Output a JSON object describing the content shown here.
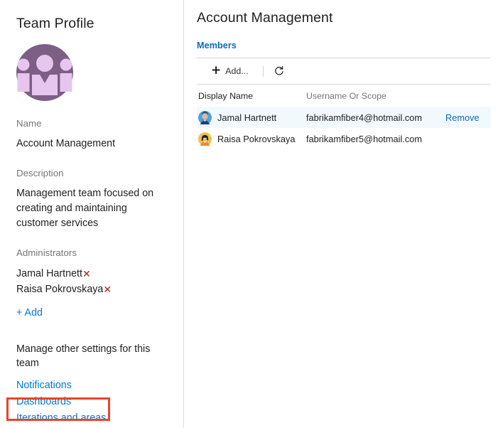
{
  "left_panel": {
    "title": "Team Profile",
    "avatar_icon": "team-group-avatar",
    "avatar_colors": {
      "circle": "#7d5f86",
      "figure": "#e6c6ef"
    },
    "name_label": "Name",
    "name_value": "Account Management",
    "description_label": "Description",
    "description_value": "Management team focused on creating and maintaining customer services",
    "administrators_label": "Administrators",
    "administrators": [
      {
        "name": "Jamal Hartnett",
        "remove_icon": "remove-x-icon"
      },
      {
        "name": "Raisa Pokrovskaya",
        "remove_icon": "remove-x-icon"
      }
    ],
    "add_admin_label": "+ Add",
    "manage_text": "Manage other settings for this team",
    "settings_links": [
      {
        "label": "Notifications",
        "highlighted": false
      },
      {
        "label": "Dashboards",
        "highlighted": false
      },
      {
        "label": "Iterations and areas",
        "highlighted": true
      }
    ],
    "highlight_color": "#e8442b"
  },
  "right_panel": {
    "title": "Account Management",
    "tabs": [
      {
        "label": "Members",
        "active": true
      }
    ],
    "toolbar": {
      "add_label": "Add...",
      "add_icon": "plus-icon",
      "refresh_icon": "refresh-icon"
    },
    "table": {
      "columns": [
        "Display Name",
        "Username Or Scope",
        ""
      ],
      "rows": [
        {
          "display_name": "Jamal Hartnett",
          "username": "fabrikamfiber4@hotmail.com",
          "action_label": "Remove",
          "avatar_icon": "user-avatar-blue",
          "selected": true
        },
        {
          "display_name": "Raisa Pokrovskaya",
          "username": "fabrikamfiber5@hotmail.com",
          "action_label": "",
          "avatar_icon": "user-avatar-yellow",
          "selected": false
        }
      ]
    }
  },
  "colors": {
    "link": "#0078d7",
    "tab_blue": "#0a6cba",
    "muted": "#767676",
    "selected_row": "#f2f9fd"
  }
}
